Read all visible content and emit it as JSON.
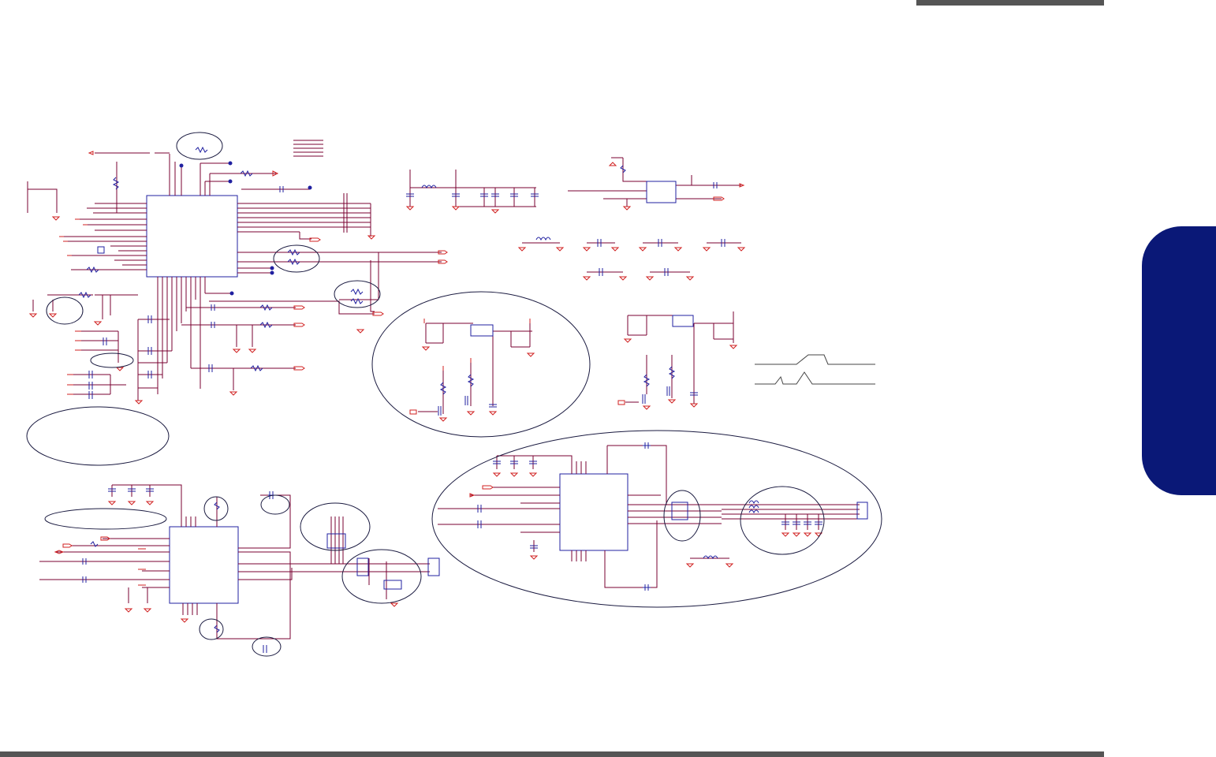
{
  "colors": {
    "wire": "#7a0030",
    "component": "#2020a0",
    "power": "#d02020",
    "annotation": "#1a1a40",
    "trace": "#444444",
    "side_tab": "#0a1877",
    "bars": "#555555"
  },
  "decorations": {
    "top_bar": "bar",
    "bottom_bar": "bar",
    "side_tab": "chapter-tab"
  }
}
